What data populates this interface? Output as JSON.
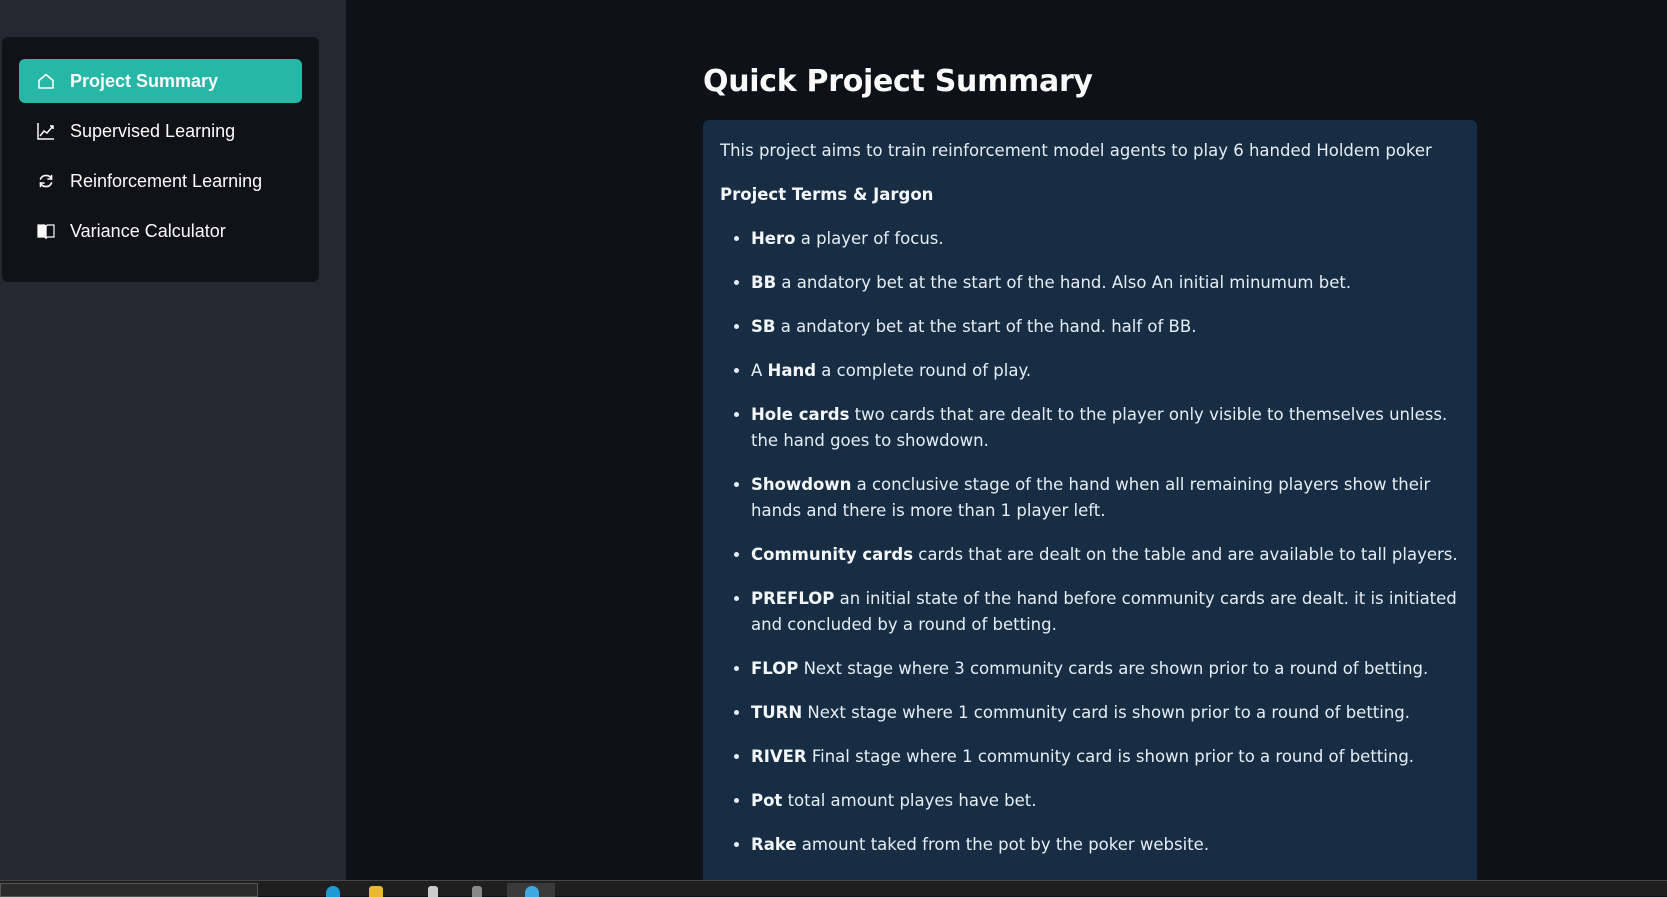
{
  "sidebar": {
    "items": [
      {
        "label": "Project Summary",
        "icon": "house-icon",
        "active": true
      },
      {
        "label": "Supervised Learning",
        "icon": "chart-line-icon",
        "active": false
      },
      {
        "label": "Reinforcement Learning",
        "icon": "refresh-icon",
        "active": false
      },
      {
        "label": "Variance Calculator",
        "icon": "book-icon",
        "active": false
      }
    ]
  },
  "main": {
    "title": "Quick Project Summary",
    "intro": "This project aims to train reinforcement model agents to play 6 handed Holdem poker",
    "terms_heading": "Project Terms & Jargon",
    "terms": [
      {
        "prefix": "",
        "term": "Hero",
        "definition": " a player of focus."
      },
      {
        "prefix": "",
        "term": "BB",
        "definition": " a andatory bet at the start of the hand. Also An initial minumum bet."
      },
      {
        "prefix": "",
        "term": "SB",
        "definition": " a andatory bet at the start of the hand. half of BB."
      },
      {
        "prefix": "A ",
        "term": "Hand",
        "definition": " a complete round of play."
      },
      {
        "prefix": "",
        "term": "Hole cards",
        "definition": " two cards that are dealt to the player only visible to themselves unless. the hand goes to showdown."
      },
      {
        "prefix": "",
        "term": "Showdown",
        "definition": " a conclusive stage of the hand when all remaining players show their hands and there is more than 1 player left."
      },
      {
        "prefix": "",
        "term": "Community cards",
        "definition": " cards that are dealt on the table and are available to tall players."
      },
      {
        "prefix": "",
        "term": "PREFLOP",
        "definition": " an initial state of the hand before community cards are dealt. it is initiated and concluded by a round of betting."
      },
      {
        "prefix": "",
        "term": "FLOP",
        "definition": " Next stage where 3 community cards are shown prior to a round of betting."
      },
      {
        "prefix": "",
        "term": "TURN",
        "definition": " Next stage where 1 community card is shown prior to a round of betting."
      },
      {
        "prefix": "",
        "term": "RIVER",
        "definition": " Final stage where 1 community card is shown prior to a round of betting."
      },
      {
        "prefix": "",
        "term": "Pot",
        "definition": " total amount playes have bet."
      },
      {
        "prefix": "",
        "term": "Rake",
        "definition": " amount taked from the pot by the poker website."
      }
    ]
  },
  "colors": {
    "accent": "#26b7a6",
    "sidebar_bg": "#262730",
    "menu_bg": "#111217",
    "main_bg": "#0e1117",
    "info_box_bg": "#172d43"
  }
}
